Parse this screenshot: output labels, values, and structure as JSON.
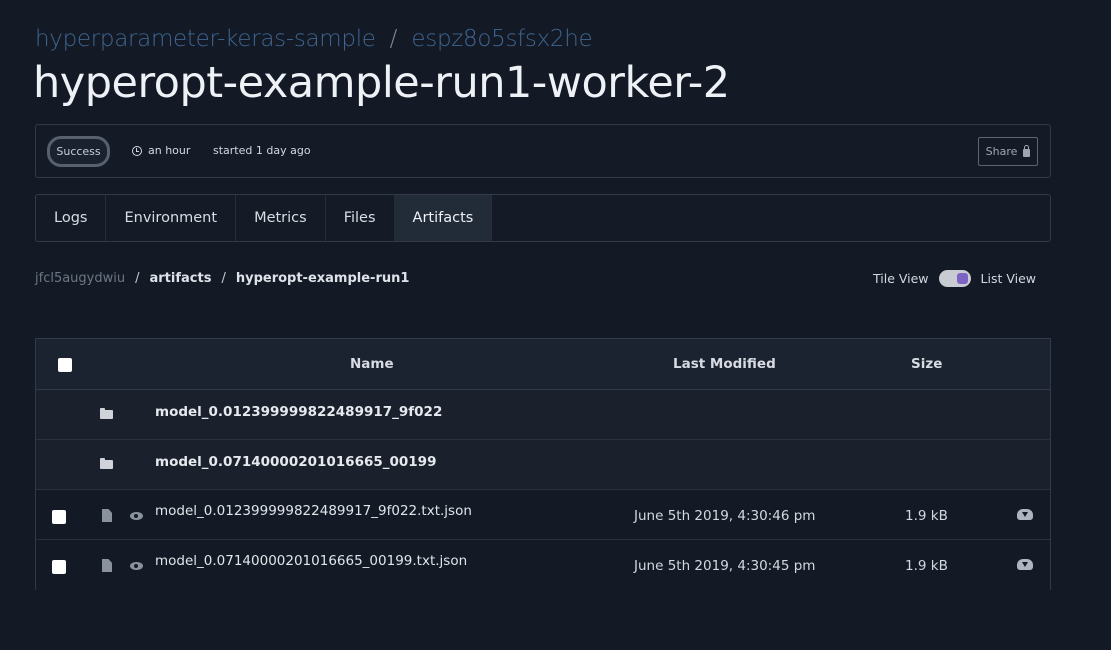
{
  "breadcrumb": {
    "project": "hyperparameter-keras-sample",
    "separator": "/",
    "experiment": "espz8o5sfsx2he"
  },
  "page_title": "hyperopt-example-run1-worker-2",
  "status": {
    "badge": "Success",
    "duration": "an hour",
    "started": "started 1 day ago",
    "share_label": "Share"
  },
  "tabs": [
    {
      "label": "Logs"
    },
    {
      "label": "Environment"
    },
    {
      "label": "Metrics"
    },
    {
      "label": "Files"
    },
    {
      "label": "Artifacts",
      "active": true
    }
  ],
  "path": {
    "root": "jfcl5augydwiu",
    "sep": "/",
    "segment1": "artifacts",
    "segment2": "hyperopt-example-run1"
  },
  "view_toggle": {
    "tile_label": "Tile View",
    "list_label": "List View",
    "selected": "List View"
  },
  "table": {
    "headers": {
      "name": "Name",
      "modified": "Last Modified",
      "size": "Size"
    },
    "directories": [
      {
        "name": "model_0.012399999822489917_9f022"
      },
      {
        "name": "model_0.07140000201016665_00199"
      }
    ],
    "files": [
      {
        "name": "model_0.012399999822489917_9f022.txt.json",
        "modified": "June 5th 2019, 4:30:46 pm",
        "size": "1.9 kB"
      },
      {
        "name": "model_0.07140000201016665_00199.txt.json",
        "modified": "June 5th 2019, 4:30:45 pm",
        "size": "1.9 kB"
      }
    ]
  },
  "colors": {
    "background": "#131a26",
    "link": "#3f6590",
    "toggle_accent": "#7d64c4"
  }
}
